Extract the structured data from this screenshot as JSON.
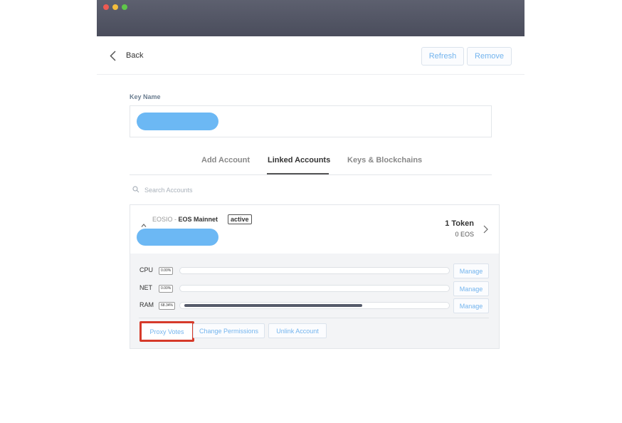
{
  "header": {
    "back_label": "Back",
    "refresh_label": "Refresh",
    "remove_label": "Remove"
  },
  "key": {
    "label": "Key Name"
  },
  "tabs": [
    {
      "label": "Add Account",
      "active": false
    },
    {
      "label": "Linked Accounts",
      "active": true
    },
    {
      "label": "Keys & Blockchains",
      "active": false
    }
  ],
  "search": {
    "placeholder": "Search Accounts"
  },
  "account": {
    "chain": "EOSIO -",
    "network": "EOS Mainnet",
    "permission": "active",
    "token_count": "1 Token",
    "token_amount": "0 EOS"
  },
  "resources": [
    {
      "label": "CPU",
      "percent": "0.00%",
      "fill_fraction": 0.0,
      "manage_label": "Manage"
    },
    {
      "label": "NET",
      "percent": "0.00%",
      "fill_fraction": 0.0,
      "manage_label": "Manage"
    },
    {
      "label": "RAM",
      "percent": "68.34%",
      "fill_fraction": 0.6834,
      "manage_label": "Manage"
    }
  ],
  "actions": {
    "proxy_votes": "Proxy Votes",
    "change_permissions": "Change Permissions",
    "unlink_account": "Unlink Account"
  },
  "colors": {
    "accent": "#73b4ee",
    "highlight": "#d63a2a",
    "redacted": "#6cb8f4"
  }
}
